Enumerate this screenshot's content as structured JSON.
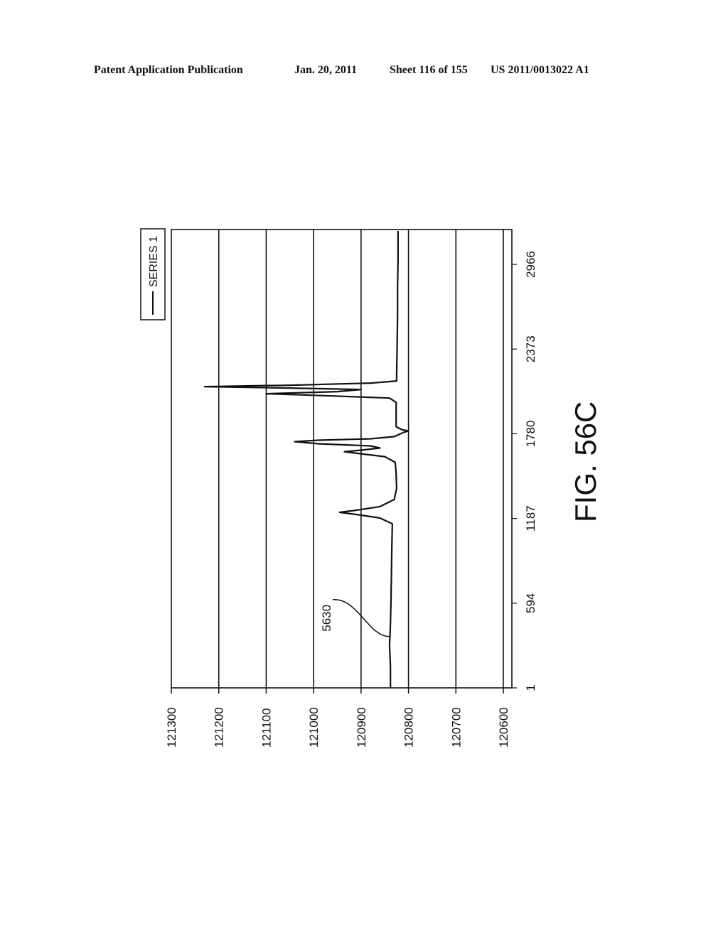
{
  "header": {
    "publication": "Patent Application Publication",
    "date": "Jan. 20, 2011",
    "sheet": "Sheet 116 of 155",
    "number": "US 2011/0013022 A1"
  },
  "figure_label": "FIG. 56C",
  "reference_numeral": "5630",
  "chart_data": {
    "type": "line",
    "orientation": "rotated 90° counter-clockwise on page",
    "title": "",
    "xlabel": "",
    "ylabel": "",
    "x_ticks": [
      "1",
      "594",
      "1187",
      "1780",
      "2373",
      "2966"
    ],
    "y_ticks": [
      "121300",
      "121200",
      "121100",
      "121000",
      "120900",
      "120800",
      "120700",
      "120600"
    ],
    "xlim": [
      1,
      3210
    ],
    "ylim": [
      120600,
      121300
    ],
    "grid": "horizontal gridlines at each y tick",
    "legend": {
      "position": "top-right",
      "entries": [
        "SERIES 1"
      ]
    },
    "series": [
      {
        "name": "SERIES 1",
        "x": [
          1,
          150,
          300,
          450,
          594,
          800,
          1000,
          1150,
          1190,
          1215,
          1230,
          1245,
          1270,
          1320,
          1400,
          1500,
          1580,
          1620,
          1640,
          1655,
          1665,
          1680,
          1695,
          1710,
          1725,
          1735,
          1745,
          1760,
          1790,
          1800,
          1810,
          1830,
          1900,
          2000,
          2030,
          2045,
          2060,
          2075,
          2090,
          2100,
          2110,
          2120,
          2135,
          2150,
          2200,
          2400,
          2600,
          2800,
          3000,
          3200
        ],
        "y": [
          120838,
          120838,
          120840,
          120838,
          120837,
          120836,
          120835,
          120834,
          120860,
          120910,
          120945,
          120910,
          120860,
          120830,
          120825,
          120826,
          120828,
          120850,
          120900,
          120935,
          120900,
          120860,
          120880,
          120990,
          121040,
          120990,
          120880,
          120830,
          120810,
          120800,
          120815,
          120826,
          120826,
          120826,
          120840,
          120960,
          121100,
          120950,
          120900,
          121050,
          121230,
          121050,
          120880,
          120825,
          120825,
          120824,
          120823,
          120823,
          120822,
          120822
        ]
      }
    ],
    "annotations": [
      {
        "text": "5630",
        "points_to_x": 360,
        "points_to_y": 120840
      }
    ]
  }
}
